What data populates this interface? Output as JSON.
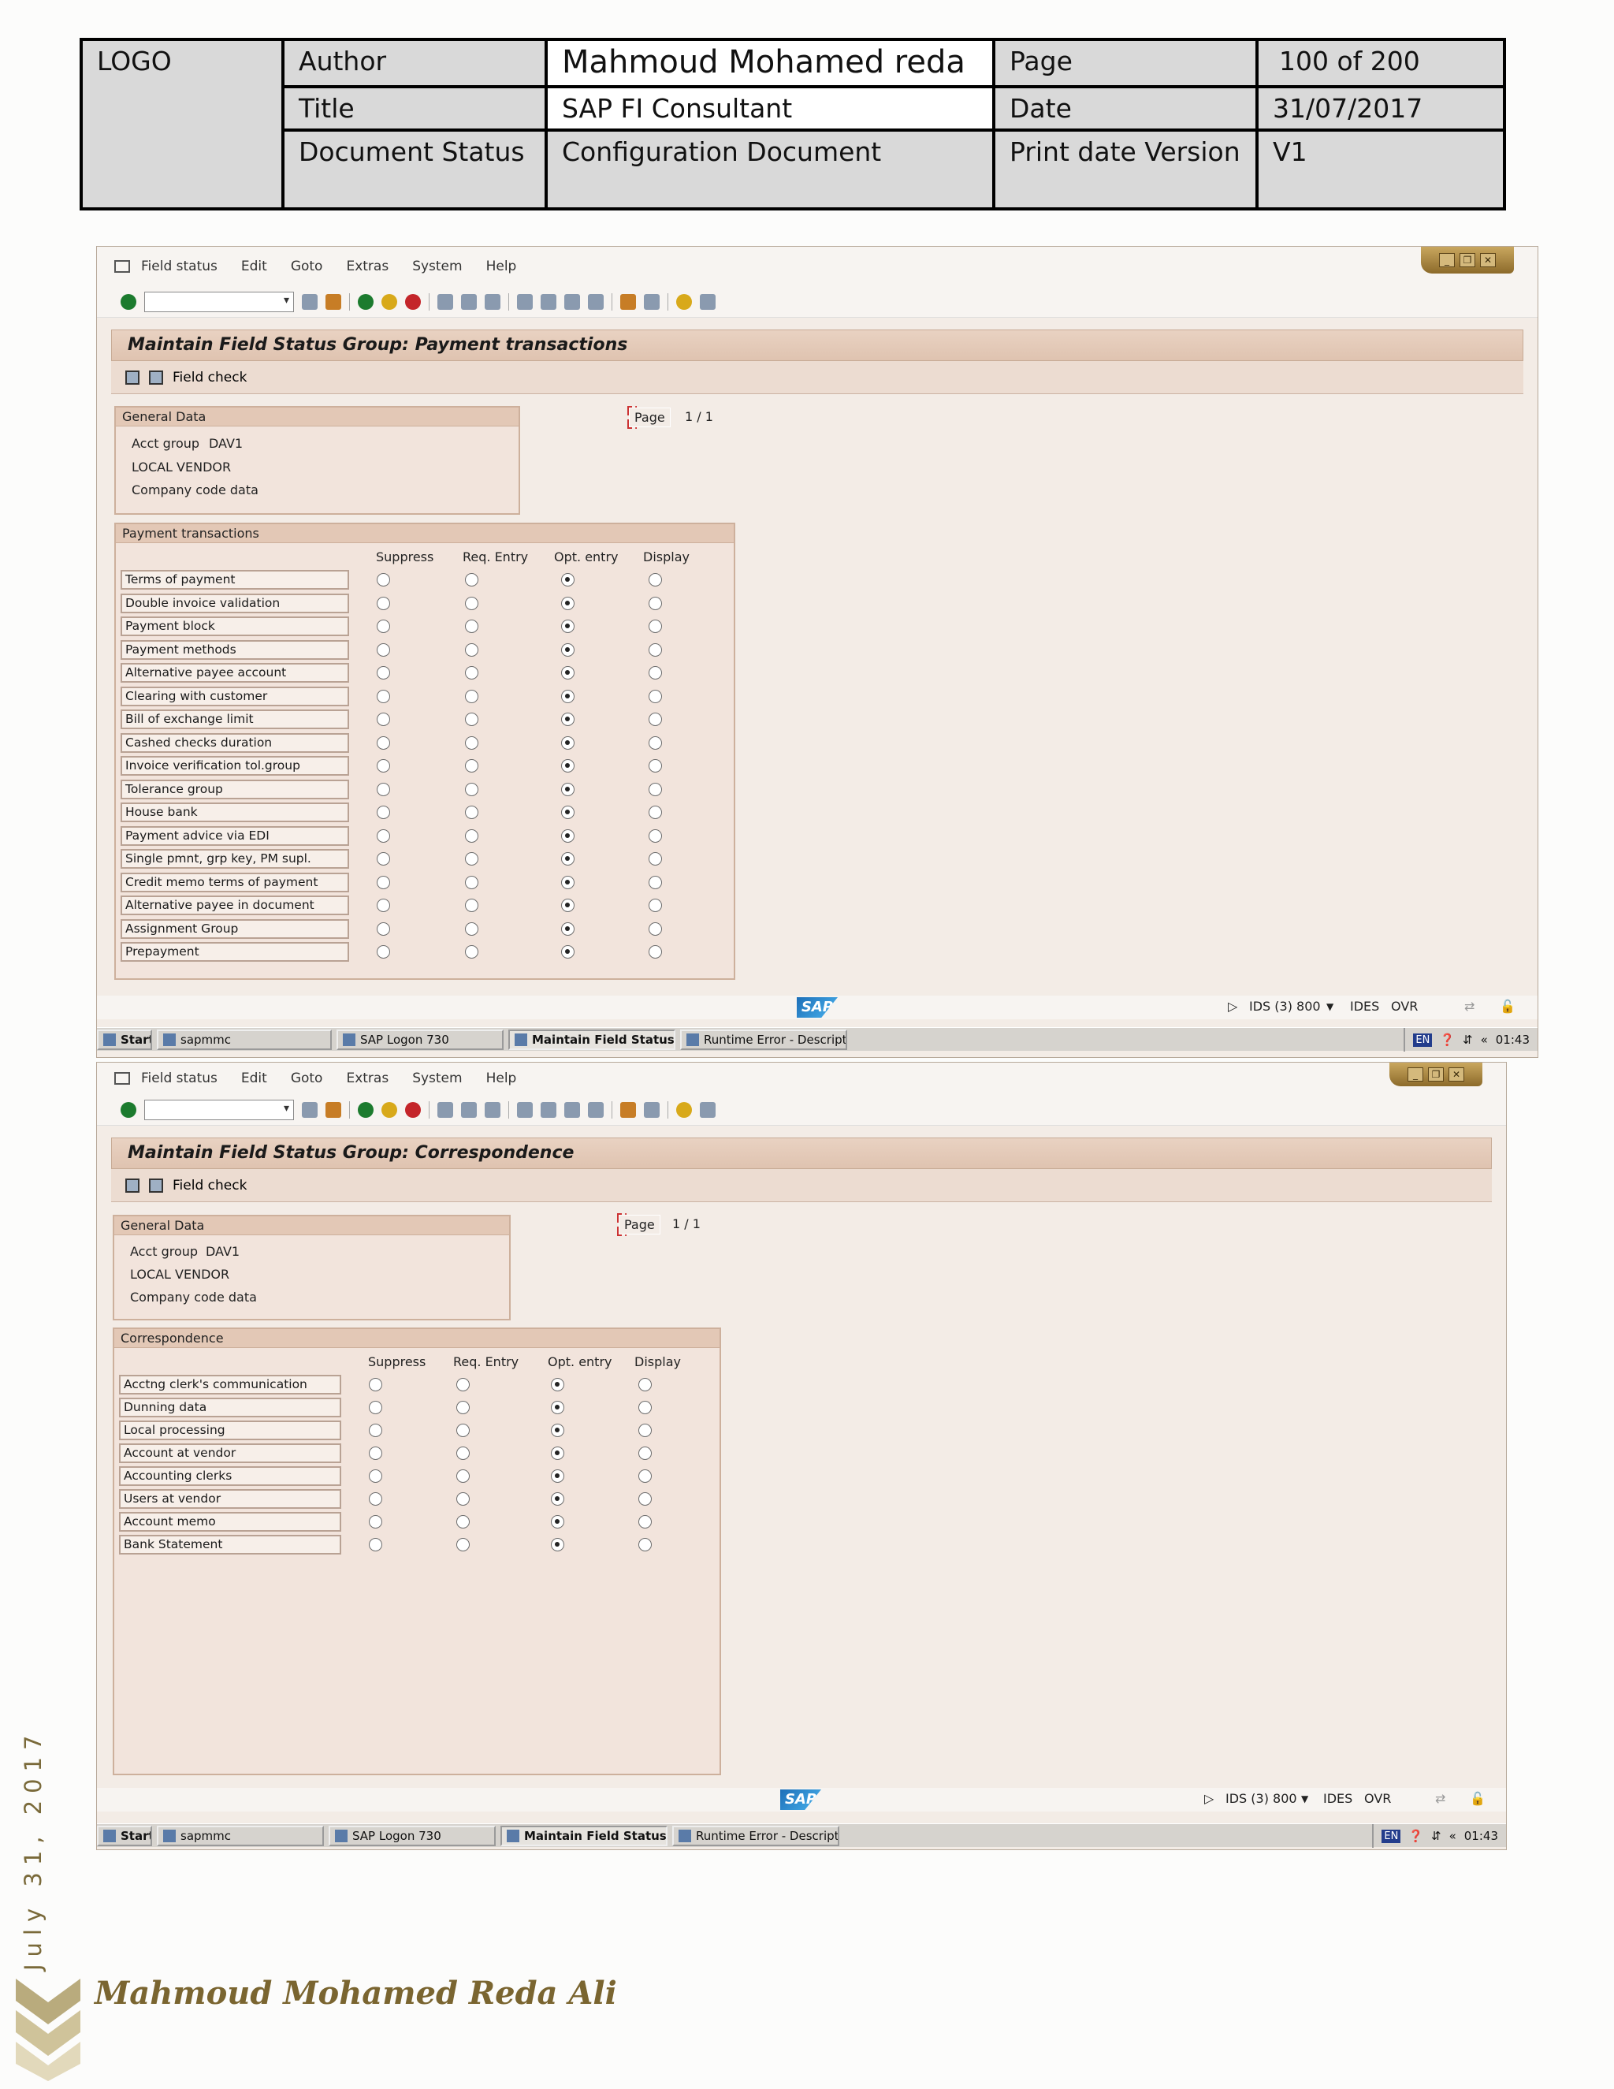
{
  "header": {
    "logo": "LOGO",
    "author_label": "Author",
    "author_value": "Mahmoud Mohamed reda",
    "page_label": "Page",
    "page_value": "100 of 200",
    "title_label": "Title",
    "title_value": "SAP FI Consultant",
    "date_label": "Date",
    "date_value": "31/07/2017",
    "status_label": "Document Status",
    "status_value": "Configuration Document",
    "version_label": "Print date Version",
    "version_value": "V1"
  },
  "menu": [
    "Field status",
    "Edit",
    "Goto",
    "Extras",
    "System",
    "Help"
  ],
  "columns": [
    "Suppress",
    "Req. Entry",
    "Opt. entry",
    "Display"
  ],
  "general": {
    "title": "General Data",
    "acct_group_label": "Acct group",
    "acct_group_value": "DAV1",
    "vendor": "LOCAL VENDOR",
    "company": "Company code data"
  },
  "page_label": "Page",
  "page_value": "1 / 1",
  "field_check": "Field check",
  "status": {
    "system": "IDS (3) 800",
    "client": "IDES",
    "mode": "OVR"
  },
  "taskbar": {
    "start": "Start",
    "items": [
      "sapmmc",
      "SAP Logon 730",
      "Maintain Field Status ...",
      "Runtime Error - Descripti..."
    ],
    "lang": "EN",
    "time": "01:43"
  },
  "screen1": {
    "title": "Maintain Field Status Group: Payment transactions",
    "group": "Payment transactions",
    "fields": [
      "Terms of payment",
      "Double invoice validation",
      "Payment block",
      "Payment methods",
      "Alternative payee account",
      "Clearing with customer",
      "Bill of exchange limit",
      "Cashed checks duration",
      "Invoice verification tol.group",
      "Tolerance group",
      "House bank",
      "Payment advice via EDI",
      "Single pmnt, grp key, PM supl.",
      "Credit memo terms of payment",
      "Alternative payee in document",
      "Assignment Group",
      "Prepayment"
    ],
    "selected": [
      "Opt. entry",
      "Opt. entry",
      "Opt. entry",
      "Opt. entry",
      "Opt. entry",
      "Opt. entry",
      "Opt. entry",
      "Opt. entry",
      "Opt. entry",
      "Opt. entry",
      "Opt. entry",
      "Opt. entry",
      "Opt. entry",
      "Opt. entry",
      "Opt. entry",
      "Opt. entry",
      "Opt. entry"
    ]
  },
  "screen2": {
    "title": "Maintain Field Status Group: Correspondence",
    "group": "Correspondence",
    "fields": [
      "Acctng clerk's communication",
      "Dunning data",
      "Local processing",
      "Account at vendor",
      "Accounting clerks",
      "Users at vendor",
      "Account memo",
      "Bank Statement"
    ],
    "selected": [
      "Opt. entry",
      "Opt. entry",
      "Opt. entry",
      "Opt. entry",
      "Opt. entry",
      "Opt. entry",
      "Opt. entry",
      "Opt. entry"
    ]
  },
  "footer": {
    "date_vertical": "July 31, 2017",
    "signature": "Mahmoud Mohamed Reda Ali"
  }
}
